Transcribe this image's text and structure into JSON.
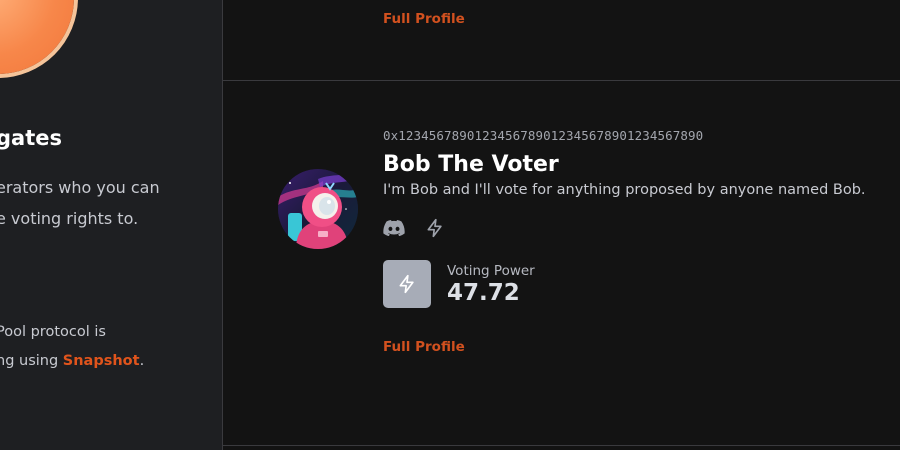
{
  "sidebar": {
    "title_fragment": "gates",
    "description_lines": [
      "erators who you can",
      "e voting rights to."
    ],
    "note_line1": "Pool protocol is",
    "note_line2_prefix": "ng using ",
    "note_link": "Snapshot",
    "note_line2_suffix": ".",
    "accent_color": "#f7874a"
  },
  "previous_card": {
    "full_profile_label": "Full Profile"
  },
  "delegate": {
    "address": "0x1234567890123456789012345678901234567890",
    "name": "Bob The Voter",
    "bio": "I'm Bob and I'll vote for anything proposed by anyone named Bob.",
    "socials": [
      {
        "icon": "discord-icon"
      },
      {
        "icon": "lightning-icon"
      }
    ],
    "voting_power_label": "Voting Power",
    "voting_power_value": "47.72",
    "full_profile_label": "Full Profile",
    "link_color": "#d2511f"
  }
}
